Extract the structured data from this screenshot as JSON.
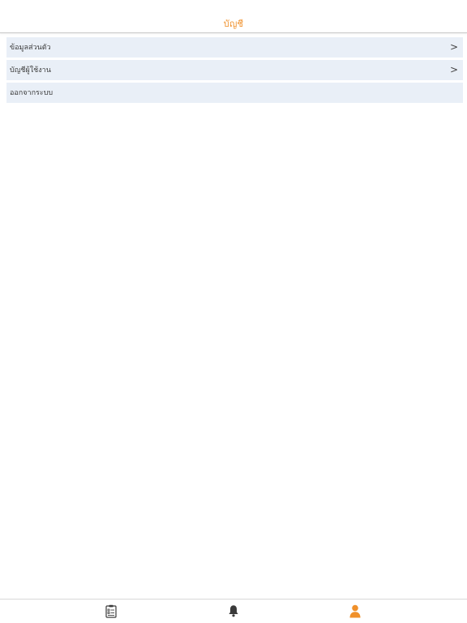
{
  "header": {
    "title": "บัญชี",
    "title_color": "#f0902a"
  },
  "menu": {
    "items": [
      {
        "label": "ข้อมูลส่วนตัว",
        "chevron": ">"
      },
      {
        "label": "บัญชีผู้ใช้งาน",
        "chevron": ">"
      },
      {
        "label": "ออกจากระบบ"
      }
    ],
    "row_background": "#e9eff7"
  },
  "tabbar": {
    "tabs": [
      {
        "icon": "clipboard-icon",
        "active": false
      },
      {
        "icon": "bell-icon",
        "active": false
      },
      {
        "icon": "user-icon",
        "active": true
      }
    ],
    "active_color": "#f0902a",
    "inactive_color": "#3a3a3a"
  }
}
